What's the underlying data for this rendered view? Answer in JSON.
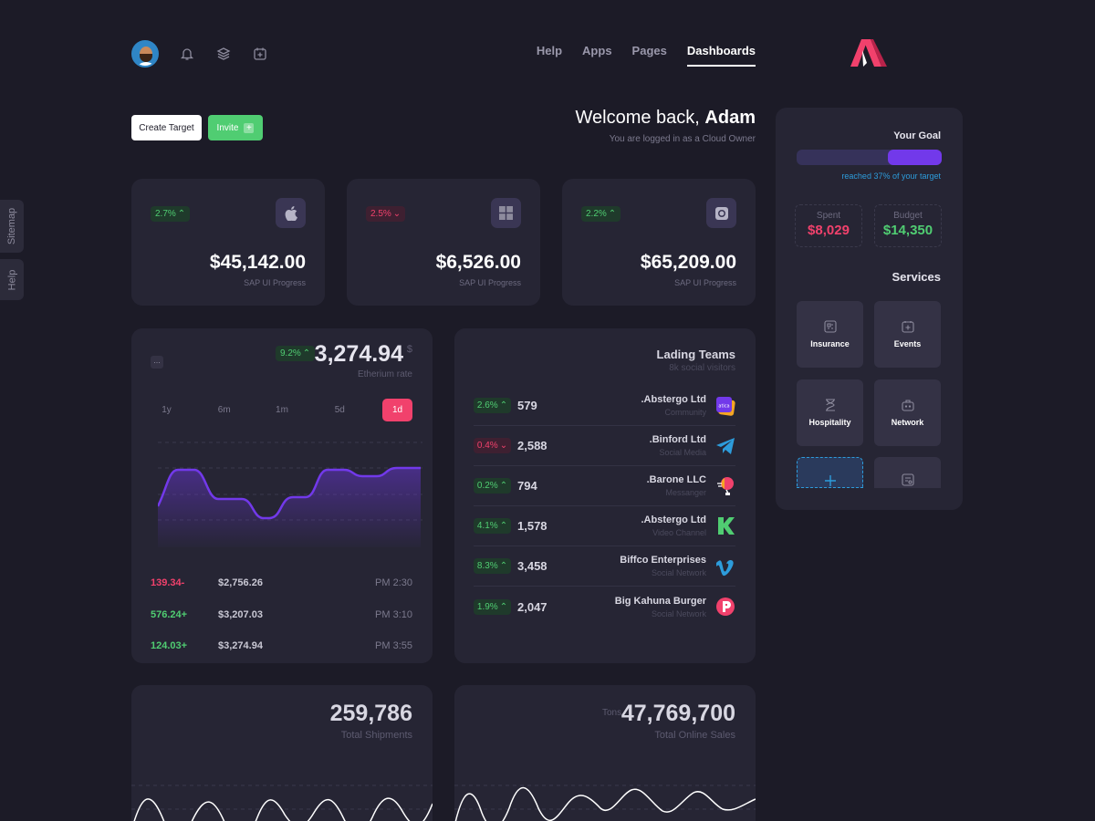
{
  "side_tabs": [
    "Sitemap",
    "Help"
  ],
  "topbar": {
    "icons": [
      "avatar",
      "bell-icon",
      "layers-icon",
      "calendar-add-icon"
    ]
  },
  "nav": {
    "items": [
      "Help",
      "Apps",
      "Pages",
      "Dashboards"
    ],
    "active": "Dashboards"
  },
  "actions": {
    "create_label": "Create Target",
    "invite_label": "Invite"
  },
  "welcome": {
    "prefix": "Welcome back,",
    "name": "Adam",
    "subtitle": "You are logged in as a Cloud Owner"
  },
  "stats": [
    {
      "change": "2.7%",
      "trend": "up",
      "icon": "apple-icon",
      "amount": "$45,142.00",
      "label": "SAP UI Progress"
    },
    {
      "change": "2.5%",
      "trend": "down",
      "icon": "windows-icon",
      "amount": "$6,526.00",
      "label": "SAP UI Progress"
    },
    {
      "change": "2.2%",
      "trend": "up",
      "icon": "camera-icon",
      "amount": "$65,209.00",
      "label": "SAP UI Progress"
    }
  ],
  "ether": {
    "dots": "...",
    "change": "9.2%",
    "value": "3,274.94",
    "currency": "$",
    "label": "Etherium rate",
    "ranges": [
      "1y",
      "6m",
      "1m",
      "5d",
      "1d"
    ],
    "active_range": "1d",
    "transactions": [
      {
        "delta": "139.34-",
        "price": "$2,756.26",
        "time": "PM 2:30",
        "trend": "down"
      },
      {
        "delta": "576.24+",
        "price": "$3,207.03",
        "time": "PM 3:10",
        "trend": "up"
      },
      {
        "delta": "124.03+",
        "price": "$3,274.94",
        "time": "PM 3:55",
        "trend": "up"
      }
    ]
  },
  "teams": {
    "title": "Lading Teams",
    "subtitle": "8k social visitors",
    "rows": [
      {
        "change": "2.6%",
        "trend": "up",
        "value": "579",
        "name": ".Abstergo Ltd",
        "category": "Community",
        "icon": "abstergo-icon",
        "color": "#7239ea"
      },
      {
        "change": "0.4%",
        "trend": "down",
        "value": "2,588",
        "name": ".Binford Ltd",
        "category": "Social Media",
        "icon": "telegram-icon",
        "color": "#2d9cdb"
      },
      {
        "change": "0.2%",
        "trend": "up",
        "value": "794",
        "name": ".Barone LLC",
        "category": "Messanger",
        "icon": "balloon-icon",
        "color": "#f1416c"
      },
      {
        "change": "4.1%",
        "trend": "up",
        "value": "1,578",
        "name": ".Abstergo Ltd",
        "category": "Video Channel",
        "icon": "kickstarter-icon",
        "color": "#50cd72"
      },
      {
        "change": "8.3%",
        "trend": "up",
        "value": "3,458",
        "name": "Biffco Enterprises",
        "category": "Social Network",
        "icon": "vimeo-icon",
        "color": "#2d9cdb"
      },
      {
        "change": "1.9%",
        "trend": "up",
        "value": "2,047",
        "name": "Big Kahuna Burger",
        "category": "Social Network",
        "icon": "producthunt-icon",
        "color": "#f1416c"
      }
    ]
  },
  "shipments": {
    "value": "259,786",
    "label": "Total Shipments"
  },
  "sales": {
    "unit": "Tons",
    "value": "47,769,700",
    "label": "Total Online Sales"
  },
  "goal": {
    "title": "Your Goal",
    "progress": 0.37,
    "progress_text": "reached 37% of your target",
    "spent_label": "Spent",
    "spent_value": "$8,029",
    "budget_label": "Budget",
    "budget_value": "$14,350",
    "services_title": "Services",
    "services": [
      {
        "label": "Insurance",
        "icon": "insurance-icon"
      },
      {
        "label": "Events",
        "icon": "events-icon"
      },
      {
        "label": "Hospitality",
        "icon": "hourglass-icon"
      },
      {
        "label": "Network",
        "icon": "network-icon"
      }
    ]
  },
  "colors": {
    "bg": "#1c1b27",
    "card": "#262534",
    "red": "#f1416c",
    "green": "#50cd72",
    "purple": "#7239ea",
    "blue": "#2d9cdb"
  }
}
